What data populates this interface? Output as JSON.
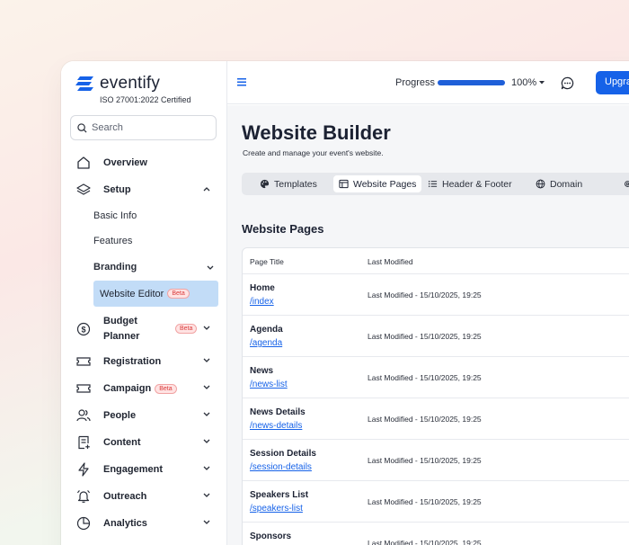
{
  "brand": {
    "name": "eventify",
    "tagline": "ISO 27001:2022 Certified",
    "color": "#1662e8"
  },
  "search": {
    "placeholder": "Search"
  },
  "sidebar": {
    "overview": "Overview",
    "setup": "Setup",
    "setup_children": {
      "basic_info": "Basic Info",
      "features": "Features",
      "branding": "Branding",
      "website_editor": "Website Editor"
    },
    "budget_planner_line1": "Budget",
    "budget_planner_line2": "Planner",
    "registration": "Registration",
    "campaign": "Campaign",
    "people": "People",
    "content": "Content",
    "engagement": "Engagement",
    "outreach": "Outreach",
    "analytics": "Analytics",
    "beta_label": "Beta"
  },
  "topbar": {
    "progress_label": "Progress",
    "progress_value": "100%",
    "progress_fraction": 1.0,
    "upgrade_label": "Upgrade"
  },
  "page": {
    "title": "Website Builder",
    "subtitle": "Create and manage your event's website."
  },
  "tabs": [
    {
      "label": "Templates",
      "icon": "palette-icon"
    },
    {
      "label": "Website Pages",
      "icon": "layout-icon"
    },
    {
      "label": "Header & Footer",
      "icon": "list-icon"
    },
    {
      "label": "Domain",
      "icon": "globe-icon"
    }
  ],
  "section": {
    "title": "Website Pages"
  },
  "table": {
    "headers": [
      "Page Title",
      "Last Modified"
    ],
    "rows": [
      {
        "title": "Home",
        "slug": "/index",
        "modified": "Last Modified - 15/10/2025, 19:25"
      },
      {
        "title": "Agenda",
        "slug": "/agenda",
        "modified": "Last Modified - 15/10/2025, 19:25"
      },
      {
        "title": "News",
        "slug": "/news-list",
        "modified": "Last Modified - 15/10/2025, 19:25"
      },
      {
        "title": "News Details",
        "slug": "/news-details",
        "modified": "Last Modified - 15/10/2025, 19:25"
      },
      {
        "title": "Session Details",
        "slug": "/session-details",
        "modified": "Last Modified - 15/10/2025, 19:25"
      },
      {
        "title": "Speakers List",
        "slug": "/speakers-list",
        "modified": "Last Modified - 15/10/2025, 19:25"
      },
      {
        "title": "Sponsors",
        "slug": "",
        "modified": "Last Modified - 15/10/2025, 19:25"
      }
    ]
  }
}
